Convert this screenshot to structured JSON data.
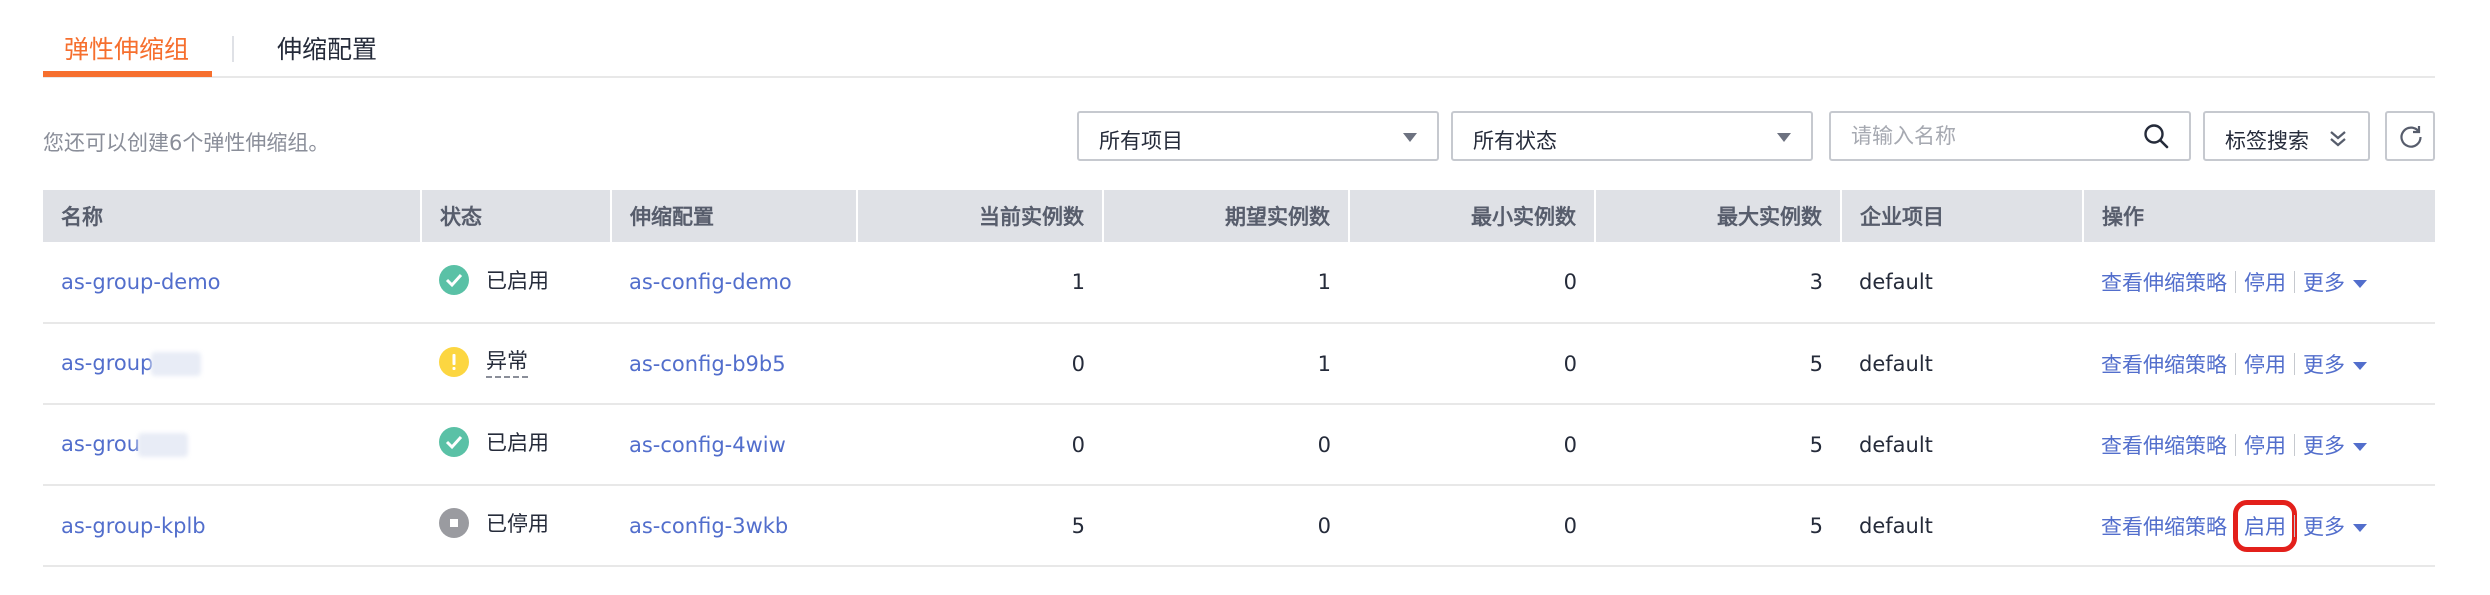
{
  "tabs": [
    {
      "label": "弹性伸缩组",
      "active": true
    },
    {
      "label": "伸缩配置",
      "active": false
    }
  ],
  "toolbar": {
    "hint": "您还可以创建6个弹性伸缩组。",
    "project_select": "所有项目",
    "status_select": "所有状态",
    "search_placeholder": "请输入名称",
    "tag_search": "标签搜索"
  },
  "table": {
    "headers": [
      "名称",
      "状态",
      "伸缩配置",
      "当前实例数",
      "期望实例数",
      "最小实例数",
      "最大实例数",
      "企业项目",
      "操作"
    ],
    "rows": [
      {
        "name": "as-group-demo",
        "status": "已启用",
        "status_type": "ok",
        "config": "as-config-demo",
        "current": "1",
        "expected": "1",
        "min": "0",
        "max": "3",
        "project": "default",
        "op_view": "查看伸缩策略",
        "op_toggle": "停用",
        "op_more": "更多"
      },
      {
        "name": "as-group",
        "status": "异常",
        "status_type": "warn",
        "config": "as-config-b9b5",
        "current": "0",
        "expected": "1",
        "min": "0",
        "max": "5",
        "project": "default",
        "op_view": "查看伸缩策略",
        "op_toggle": "停用",
        "op_more": "更多"
      },
      {
        "name": "as-grou",
        "status": "已启用",
        "status_type": "ok",
        "config": "as-config-4wiw",
        "current": "0",
        "expected": "0",
        "min": "0",
        "max": "5",
        "project": "default",
        "op_view": "查看伸缩策略",
        "op_toggle": "停用",
        "op_more": "更多"
      },
      {
        "name": "as-group-kplb",
        "status": "已停用",
        "status_type": "stop",
        "config": "as-config-3wkb",
        "current": "5",
        "expected": "0",
        "min": "0",
        "max": "5",
        "project": "default",
        "op_view": "查看伸缩策略",
        "op_toggle": "启用",
        "op_more": "更多"
      }
    ]
  },
  "colors": {
    "accent": "#f66f2e",
    "link": "#526ecc",
    "status_ok": "#5ac1a6",
    "status_warn": "#fcd641",
    "status_stop": "#9a9ba0",
    "highlight": "#e3201b"
  }
}
